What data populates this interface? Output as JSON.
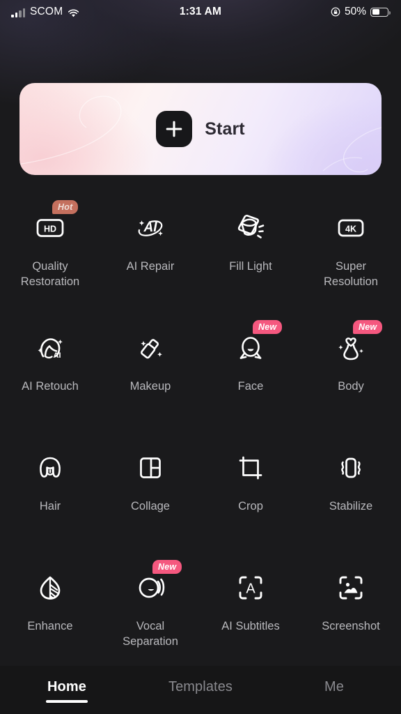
{
  "status_bar": {
    "carrier": "SCOM",
    "signal_icon": "cellular-bars-icon",
    "wifi_icon": "wifi-icon",
    "time": "1:31 AM",
    "lock_icon": "rotation-lock-icon",
    "battery_percent": "50%",
    "battery_level": 50,
    "battery_icon": "battery-icon"
  },
  "banner": {
    "name": "start-banner",
    "plus_icon": "plus-icon",
    "label": "Start",
    "gradient_from": "#fbdfe0",
    "gradient_to": "#ddd4fa"
  },
  "colors": {
    "background": "#1a1a1c",
    "tabbar": "#161617",
    "label": "#b9b9bd",
    "badge_hot": "#c4705e",
    "badge_new": "#f5587f",
    "accent_white": "#ffffff"
  },
  "tools": [
    {
      "id": "quality-restoration",
      "label": "Quality\nRestoration",
      "icon": "hd-badge-icon",
      "badge": "Hot",
      "badge_type": "hot"
    },
    {
      "id": "ai-repair",
      "label": "AI Repair",
      "icon": "ai-orbit-icon",
      "badge": null,
      "badge_type": null
    },
    {
      "id": "fill-light",
      "label": "Fill Light",
      "icon": "spotlight-icon",
      "badge": null,
      "badge_type": null
    },
    {
      "id": "super-resolution",
      "label": "Super\nResolution",
      "icon": "4k-badge-icon",
      "badge": null,
      "badge_type": null
    },
    {
      "id": "ai-retouch",
      "label": "AI Retouch",
      "icon": "face-profile-ai-icon",
      "badge": null,
      "badge_type": null
    },
    {
      "id": "makeup",
      "label": "Makeup",
      "icon": "lipstick-icon",
      "badge": null,
      "badge_type": null
    },
    {
      "id": "face",
      "label": "Face",
      "icon": "face-oval-icon",
      "badge": "New",
      "badge_type": "new"
    },
    {
      "id": "body",
      "label": "Body",
      "icon": "body-silhouette-icon",
      "badge": "New",
      "badge_type": "new"
    },
    {
      "id": "hair",
      "label": "Hair",
      "icon": "hairstyle-icon",
      "badge": null,
      "badge_type": null
    },
    {
      "id": "collage",
      "label": "Collage",
      "icon": "collage-grid-icon",
      "badge": null,
      "badge_type": null
    },
    {
      "id": "crop",
      "label": "Crop",
      "icon": "crop-icon",
      "badge": null,
      "badge_type": null
    },
    {
      "id": "stabilize",
      "label": "Stabilize",
      "icon": "stabilize-icon",
      "badge": null,
      "badge_type": null
    },
    {
      "id": "enhance",
      "label": "Enhance",
      "icon": "leaf-contrast-icon",
      "badge": null,
      "badge_type": null
    },
    {
      "id": "vocal-separation",
      "label": "Vocal\nSeparation",
      "icon": "voice-wave-icon",
      "badge": "New",
      "badge_type": "new"
    },
    {
      "id": "ai-subtitles",
      "label": "AI Subtitles",
      "icon": "subtitle-frame-icon",
      "badge": null,
      "badge_type": null
    },
    {
      "id": "screenshot",
      "label": "Screenshot",
      "icon": "screenshot-frame-icon",
      "badge": null,
      "badge_type": null
    }
  ],
  "tabs": [
    {
      "id": "home",
      "label": "Home",
      "active": true
    },
    {
      "id": "templates",
      "label": "Templates",
      "active": false
    },
    {
      "id": "me",
      "label": "Me",
      "active": false
    }
  ]
}
